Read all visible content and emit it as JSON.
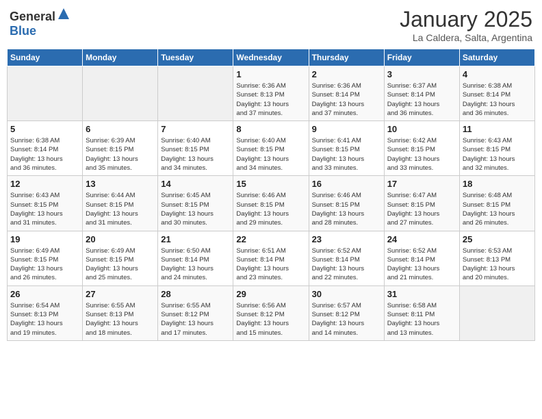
{
  "header": {
    "logo_general": "General",
    "logo_blue": "Blue",
    "month_year": "January 2025",
    "location": "La Caldera, Salta, Argentina"
  },
  "days_of_week": [
    "Sunday",
    "Monday",
    "Tuesday",
    "Wednesday",
    "Thursday",
    "Friday",
    "Saturday"
  ],
  "weeks": [
    {
      "cells": [
        {
          "num": "",
          "info": ""
        },
        {
          "num": "",
          "info": ""
        },
        {
          "num": "",
          "info": ""
        },
        {
          "num": "1",
          "info": "Sunrise: 6:36 AM\nSunset: 8:13 PM\nDaylight: 13 hours\nand 37 minutes."
        },
        {
          "num": "2",
          "info": "Sunrise: 6:36 AM\nSunset: 8:14 PM\nDaylight: 13 hours\nand 37 minutes."
        },
        {
          "num": "3",
          "info": "Sunrise: 6:37 AM\nSunset: 8:14 PM\nDaylight: 13 hours\nand 36 minutes."
        },
        {
          "num": "4",
          "info": "Sunrise: 6:38 AM\nSunset: 8:14 PM\nDaylight: 13 hours\nand 36 minutes."
        }
      ]
    },
    {
      "cells": [
        {
          "num": "5",
          "info": "Sunrise: 6:38 AM\nSunset: 8:14 PM\nDaylight: 13 hours\nand 36 minutes."
        },
        {
          "num": "6",
          "info": "Sunrise: 6:39 AM\nSunset: 8:15 PM\nDaylight: 13 hours\nand 35 minutes."
        },
        {
          "num": "7",
          "info": "Sunrise: 6:40 AM\nSunset: 8:15 PM\nDaylight: 13 hours\nand 34 minutes."
        },
        {
          "num": "8",
          "info": "Sunrise: 6:40 AM\nSunset: 8:15 PM\nDaylight: 13 hours\nand 34 minutes."
        },
        {
          "num": "9",
          "info": "Sunrise: 6:41 AM\nSunset: 8:15 PM\nDaylight: 13 hours\nand 33 minutes."
        },
        {
          "num": "10",
          "info": "Sunrise: 6:42 AM\nSunset: 8:15 PM\nDaylight: 13 hours\nand 33 minutes."
        },
        {
          "num": "11",
          "info": "Sunrise: 6:43 AM\nSunset: 8:15 PM\nDaylight: 13 hours\nand 32 minutes."
        }
      ]
    },
    {
      "cells": [
        {
          "num": "12",
          "info": "Sunrise: 6:43 AM\nSunset: 8:15 PM\nDaylight: 13 hours\nand 31 minutes."
        },
        {
          "num": "13",
          "info": "Sunrise: 6:44 AM\nSunset: 8:15 PM\nDaylight: 13 hours\nand 31 minutes."
        },
        {
          "num": "14",
          "info": "Sunrise: 6:45 AM\nSunset: 8:15 PM\nDaylight: 13 hours\nand 30 minutes."
        },
        {
          "num": "15",
          "info": "Sunrise: 6:46 AM\nSunset: 8:15 PM\nDaylight: 13 hours\nand 29 minutes."
        },
        {
          "num": "16",
          "info": "Sunrise: 6:46 AM\nSunset: 8:15 PM\nDaylight: 13 hours\nand 28 minutes."
        },
        {
          "num": "17",
          "info": "Sunrise: 6:47 AM\nSunset: 8:15 PM\nDaylight: 13 hours\nand 27 minutes."
        },
        {
          "num": "18",
          "info": "Sunrise: 6:48 AM\nSunset: 8:15 PM\nDaylight: 13 hours\nand 26 minutes."
        }
      ]
    },
    {
      "cells": [
        {
          "num": "19",
          "info": "Sunrise: 6:49 AM\nSunset: 8:15 PM\nDaylight: 13 hours\nand 26 minutes."
        },
        {
          "num": "20",
          "info": "Sunrise: 6:49 AM\nSunset: 8:15 PM\nDaylight: 13 hours\nand 25 minutes."
        },
        {
          "num": "21",
          "info": "Sunrise: 6:50 AM\nSunset: 8:14 PM\nDaylight: 13 hours\nand 24 minutes."
        },
        {
          "num": "22",
          "info": "Sunrise: 6:51 AM\nSunset: 8:14 PM\nDaylight: 13 hours\nand 23 minutes."
        },
        {
          "num": "23",
          "info": "Sunrise: 6:52 AM\nSunset: 8:14 PM\nDaylight: 13 hours\nand 22 minutes."
        },
        {
          "num": "24",
          "info": "Sunrise: 6:52 AM\nSunset: 8:14 PM\nDaylight: 13 hours\nand 21 minutes."
        },
        {
          "num": "25",
          "info": "Sunrise: 6:53 AM\nSunset: 8:13 PM\nDaylight: 13 hours\nand 20 minutes."
        }
      ]
    },
    {
      "cells": [
        {
          "num": "26",
          "info": "Sunrise: 6:54 AM\nSunset: 8:13 PM\nDaylight: 13 hours\nand 19 minutes."
        },
        {
          "num": "27",
          "info": "Sunrise: 6:55 AM\nSunset: 8:13 PM\nDaylight: 13 hours\nand 18 minutes."
        },
        {
          "num": "28",
          "info": "Sunrise: 6:55 AM\nSunset: 8:12 PM\nDaylight: 13 hours\nand 17 minutes."
        },
        {
          "num": "29",
          "info": "Sunrise: 6:56 AM\nSunset: 8:12 PM\nDaylight: 13 hours\nand 15 minutes."
        },
        {
          "num": "30",
          "info": "Sunrise: 6:57 AM\nSunset: 8:12 PM\nDaylight: 13 hours\nand 14 minutes."
        },
        {
          "num": "31",
          "info": "Sunrise: 6:58 AM\nSunset: 8:11 PM\nDaylight: 13 hours\nand 13 minutes."
        },
        {
          "num": "",
          "info": ""
        }
      ]
    }
  ]
}
